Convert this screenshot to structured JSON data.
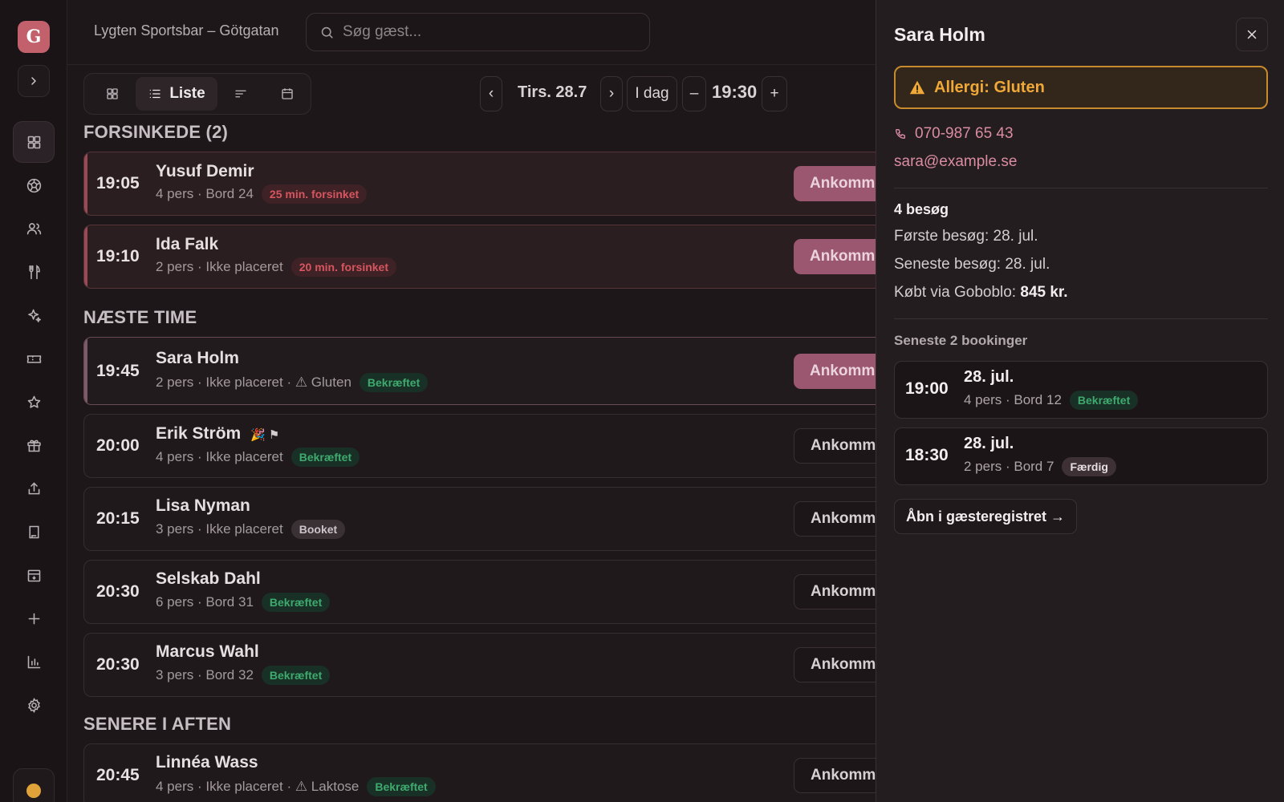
{
  "app": {
    "logo_letter": "G",
    "venue": "Lygten Sportsbar – Götgatan"
  },
  "search": {
    "placeholder": "Søg gæst..."
  },
  "rail": {
    "items": [
      "grid-icon",
      "soccer-ball-icon",
      "users-icon",
      "cutlery-icon",
      "sparkle-icon",
      "ticket-icon",
      "star-icon",
      "gift-icon",
      "share-icon",
      "book-icon",
      "archive-icon",
      "plus-icon",
      "bar-chart-icon",
      "settings-icon"
    ],
    "active": "grid-icon"
  },
  "toolbar": {
    "views": [
      {
        "icon": "grid-icon"
      },
      {
        "icon": "list-icon",
        "label": "Liste",
        "active": true
      },
      {
        "icon": "sort-icon"
      },
      {
        "icon": "calendar-icon"
      }
    ],
    "date": "Tirs. 28.7",
    "prev": "‹",
    "next": "›",
    "today": "I dag",
    "minus": "–",
    "time": "19:30",
    "plus": "+"
  },
  "sections": [
    {
      "title": "FORSINKEDE (2)"
    },
    {
      "title": "NÆSTE TIME"
    },
    {
      "title": "SENERE I AFTEN"
    }
  ],
  "arrive_label": "Ankommet",
  "reservations": [
    {
      "time": "19:05",
      "name": "Yusuf Demir",
      "meta": "4 pers · Bord 24",
      "badge": "25 min. forsinket",
      "badge_type": "late"
    },
    {
      "time": "19:10",
      "name": "Ida Falk",
      "meta": "2 pers · Ikke placeret",
      "badge": "20 min. forsinket",
      "badge_type": "late"
    },
    {
      "time": "19:45",
      "name": "Sara Holm",
      "meta": "2 pers · Ikke placeret · ⚠ Gluten",
      "badge": "Bekræftet",
      "badge_type": "ok"
    },
    {
      "time": "20:00",
      "name": "Erik Ström",
      "name_icons": "🎉 ⚑",
      "meta": "4 pers · Ikke placeret",
      "badge": "Bekræftet",
      "badge_type": "ok"
    },
    {
      "time": "20:15",
      "name": "Lisa Nyman",
      "meta": "3 pers · Ikke placeret",
      "badge": "Booket",
      "badge_type": "booked"
    },
    {
      "time": "20:30",
      "name": "Selskab Dahl",
      "meta": "6 pers · Bord 31",
      "badge": "Bekræftet",
      "badge_type": "ok"
    },
    {
      "time": "20:30",
      "name": "Marcus Wahl",
      "meta": "3 pers · Bord 32",
      "badge": "Bekræftet",
      "badge_type": "ok"
    },
    {
      "time": "20:45",
      "name": "Linnéa Wass",
      "meta": "4 pers · Ikke placeret · ⚠ Laktose",
      "badge": "Bekræftet",
      "badge_type": "ok"
    }
  ],
  "drawer": {
    "name": "Sara Holm",
    "allergy": "Allergi: Gluten",
    "phone": "070-987 65 43",
    "email": "sara@example.se",
    "visits": "4 besøg",
    "first_visit": "Første besøg: 28. jul.",
    "last_visit": "Seneste besøg: 28. jul.",
    "bought_label": "Købt via Goboblo:",
    "bought_value": "845 kr.",
    "recent_title": "Seneste 2 bookinger",
    "bookings": [
      {
        "time": "19:00",
        "date": "28. jul.",
        "meta": "4 pers · Bord 12",
        "badge": "Bekræftet",
        "badge_type": "ok"
      },
      {
        "time": "18:30",
        "date": "28. jul.",
        "meta": "2 pers · Bord 7",
        "badge": "Færdig",
        "badge_type": "done"
      }
    ],
    "open_registry": "Åbn i gæsteregistret →"
  },
  "colors": {
    "accent": "#c2606c",
    "late": "#d7555f",
    "confirmed": "#3eaa6e",
    "allergy": "#f0a838",
    "link": "#d98ca2"
  }
}
